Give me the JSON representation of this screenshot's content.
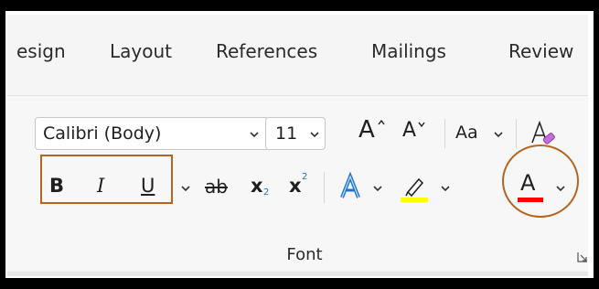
{
  "tabs": [
    {
      "label": "esign"
    },
    {
      "label": "Layout"
    },
    {
      "label": "References"
    },
    {
      "label": "Mailings"
    },
    {
      "label": "Review"
    }
  ],
  "font_group": {
    "font_name": "Calibri (Body)",
    "font_size": "11",
    "grow_font_label": "A",
    "shrink_font_label": "A",
    "change_case_label": "Aa",
    "bold_label": "B",
    "italic_label": "I",
    "underline_label": "U",
    "strikethrough_label": "ab",
    "subscript_label": "x",
    "subscript_sub": "2",
    "superscript_label": "x",
    "superscript_sup": "2",
    "font_color_label": "A",
    "group_label": "Font"
  },
  "colors": {
    "highlight_yellow": "#ffff00",
    "font_color_red": "#ff0000",
    "annotation_brown": "#b5651d",
    "text_effects_blue": "#1e73d8"
  },
  "icons": [
    "chevron-down-icon",
    "grow-font-icon",
    "shrink-font-icon",
    "clear-formatting-icon",
    "text-effects-icon",
    "highlighter-icon",
    "font-color-icon",
    "dialog-launcher-icon"
  ]
}
